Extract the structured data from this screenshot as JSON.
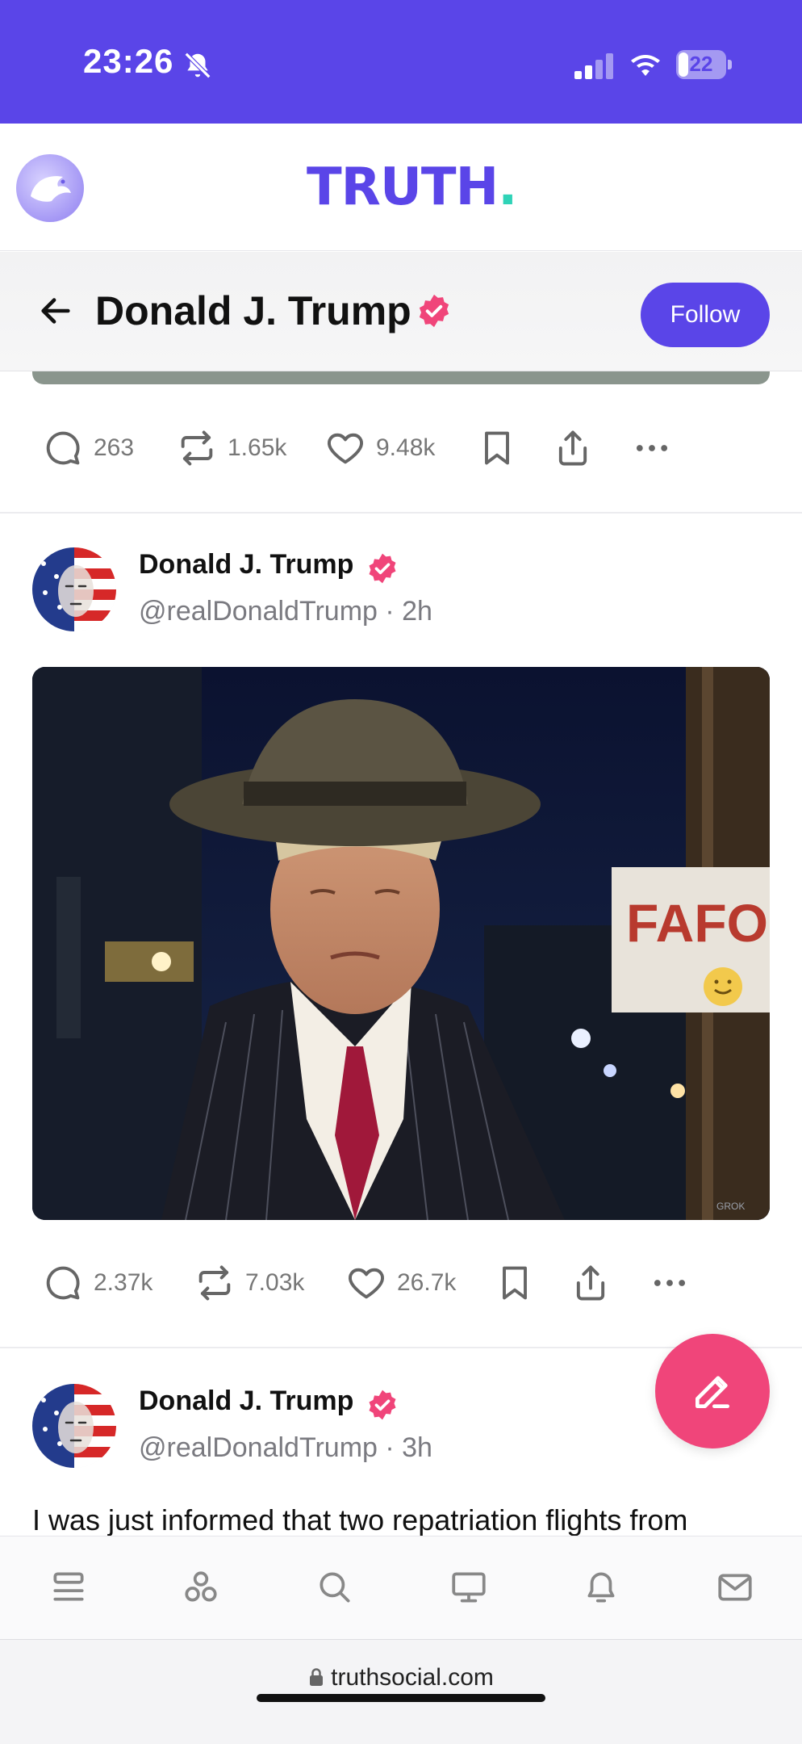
{
  "status_bar": {
    "time": "23:26",
    "battery": "22",
    "battery_level": 0.22
  },
  "app": {
    "logo_text": "TRUTH",
    "logo_dot": ".",
    "brand_color": "#5a45e8",
    "accent_color": "#f0457a"
  },
  "profile": {
    "name": "Donald J. Trump",
    "follow_label": "Follow"
  },
  "previous_post_actions": {
    "replies": "263",
    "reposts": "1.65k",
    "likes": "9.48k"
  },
  "posts": [
    {
      "author": "Donald J. Trump",
      "handle": "@realDonaldTrump · 2h",
      "image_sign_text": "FAFO",
      "image_watermark": "GROK",
      "actions": {
        "replies": "2.37k",
        "reposts": "7.03k",
        "likes": "26.7k"
      }
    },
    {
      "author": "Donald J. Trump",
      "handle": "@realDonaldTrump · 3h",
      "text": "I was just informed that two repatriation flights from"
    }
  ],
  "bottom_nav": {
    "items": [
      "feed-icon",
      "groups-icon",
      "search-icon",
      "tv-icon",
      "notifications-icon",
      "messages-icon"
    ]
  },
  "browser": {
    "url": "truthsocial.com"
  }
}
